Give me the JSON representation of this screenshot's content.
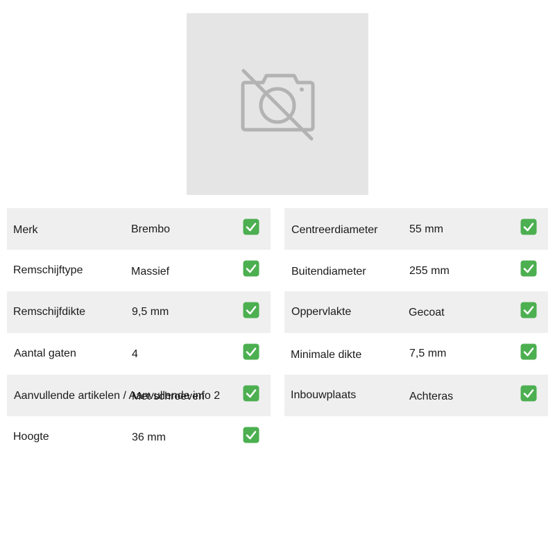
{
  "image": {
    "icon": "camera-off-icon"
  },
  "left_specs": [
    {
      "label": "Merk",
      "value": "Brembo",
      "status": "check"
    },
    {
      "label": "Remschijftype",
      "value": "Massief",
      "status": "check"
    },
    {
      "label": "Remschijfdikte",
      "value": "9,5 mm",
      "status": "check"
    },
    {
      "label": "Aantal gaten",
      "value": "4",
      "status": "check"
    },
    {
      "label": "Aanvullende artikelen / Aanvullende info 2",
      "value": "Met schroeven",
      "status": "check"
    },
    {
      "label": "Hoogte",
      "value": "36 mm",
      "status": "check"
    }
  ],
  "right_specs": [
    {
      "label": "Centreerdiameter",
      "value": "55 mm",
      "status": "check"
    },
    {
      "label": "Buitendiameter",
      "value": "255 mm",
      "status": "check"
    },
    {
      "label": "Oppervlakte",
      "value": "Gecoat",
      "status": "check"
    },
    {
      "label": "Minimale dikte",
      "value": "7,5 mm",
      "status": "check"
    },
    {
      "label": "Inbouwplaats",
      "value": "Achteras",
      "status": "check"
    }
  ],
  "colors": {
    "row_shade": "#efefef",
    "image_bg": "#e5e5e5",
    "icon_gray": "#b3b3b3",
    "check_green": "#4caf50"
  }
}
